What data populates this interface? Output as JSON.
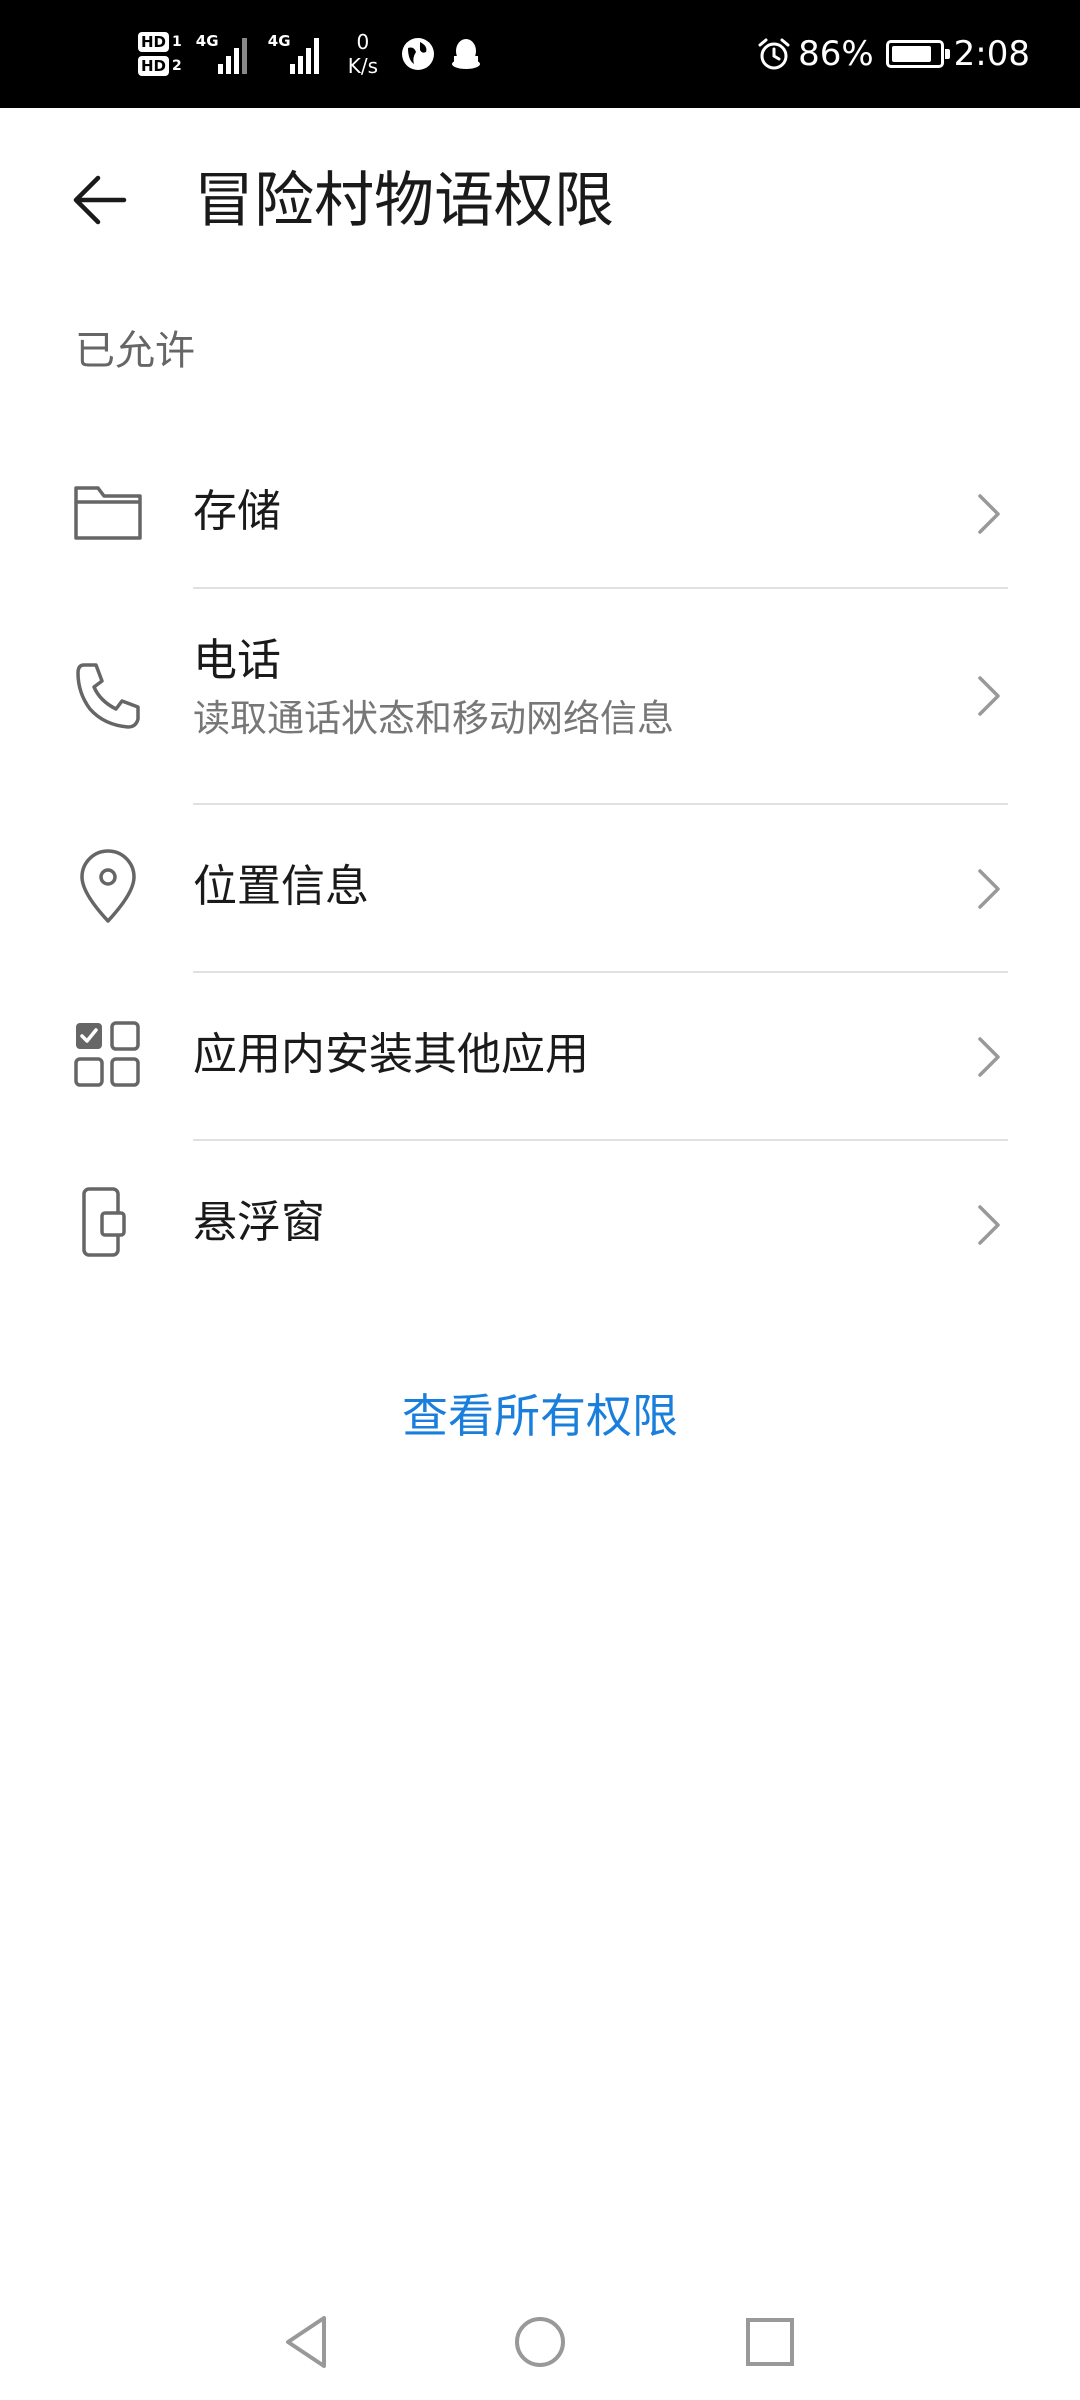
{
  "status_bar": {
    "hd1": "HD",
    "hd1_num": "1",
    "hd2": "HD",
    "hd2_num": "2",
    "signal1_label": "4G",
    "signal2_label": "4G",
    "speed_value": "0",
    "speed_unit": "K/s",
    "battery_percent": "86%",
    "battery_level": 0.86,
    "time": "2:08",
    "icons": [
      "hd-icon",
      "signal-icon",
      "signal-icon",
      "browser-icon",
      "qq-icon",
      "alarm-icon",
      "battery-icon"
    ]
  },
  "header": {
    "title": "冒险村物语权限",
    "back_icon": "arrow-left-icon"
  },
  "section": {
    "label": "已允许"
  },
  "permissions": [
    {
      "label": "存储",
      "subtitle": "",
      "icon": "folder-icon"
    },
    {
      "label": "电话",
      "subtitle": "读取通话状态和移动网络信息",
      "icon": "phone-icon"
    },
    {
      "label": "位置信息",
      "subtitle": "",
      "icon": "location-pin-icon"
    },
    {
      "label": "应用内安装其他应用",
      "subtitle": "",
      "icon": "app-grid-icon"
    },
    {
      "label": "悬浮窗",
      "subtitle": "",
      "icon": "floating-window-icon"
    }
  ],
  "view_all": {
    "label": "查看所有权限"
  },
  "colors": {
    "accent": "#1a7fdc",
    "status_bar_bg": "#000000",
    "divider": "#e0e0e0",
    "icon": "#666666"
  },
  "nav_bar": {
    "icons": [
      "back-triangle-icon",
      "home-circle-icon",
      "recents-square-icon"
    ]
  }
}
